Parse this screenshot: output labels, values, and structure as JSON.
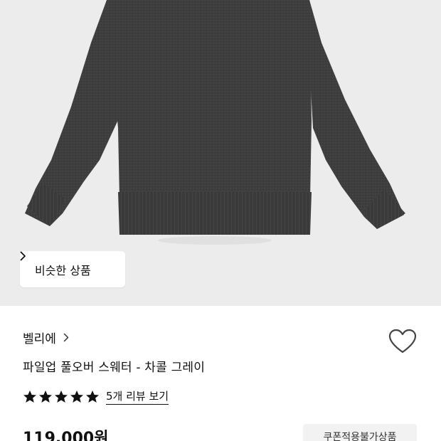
{
  "product": {
    "similar_button_label": "비슷한 상품",
    "brand": "벨리에",
    "title": "파일업 풀오버 스웨터 - 차콜 그레이",
    "rating_stars": 5,
    "review_link": "5개 리뷰 보기",
    "price": "119,000원",
    "coupon_badge": "쿠폰적용불가상품"
  },
  "icons": {
    "similar_chevron": "chevron-right-icon",
    "brand_chevron": "chevron-right-icon",
    "wishlist": "heart-outline-icon",
    "star": "star-filled-icon"
  },
  "colors": {
    "image_background": "#ececec",
    "sweater": "#3d3d3d",
    "text": "#111111",
    "badge_background": "#f2f2f2"
  }
}
